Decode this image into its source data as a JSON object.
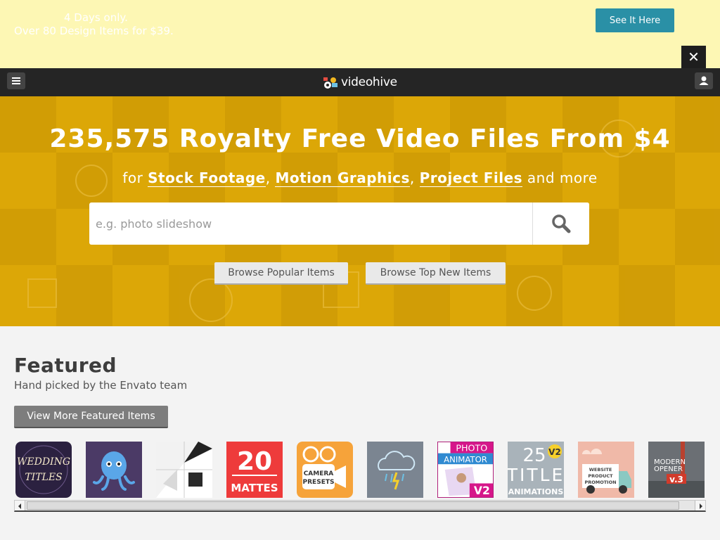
{
  "promo": {
    "line1": "4 Days only.",
    "line2": "Over 80 Design Items for $39.",
    "cta_label": "See It Here",
    "close_glyph": "✕"
  },
  "topbar": {
    "menu_icon": "hamburger-icon",
    "logo_text": "videohive",
    "user_icon": "user-icon"
  },
  "hero": {
    "title": "235,575 Royalty Free Video Files From $4",
    "sub_prefix": "for",
    "categories": [
      "Stock Footage",
      "Motion Graphics",
      "Project Files"
    ],
    "sub_suffix": "and more",
    "search_placeholder": "e.g. photo slideshow",
    "search_icon": "search-icon",
    "browse_popular": "Browse Popular Items",
    "browse_new": "Browse Top New Items"
  },
  "featured": {
    "title": "Featured",
    "subtitle": "Hand picked by the Envato team",
    "more_label": "View More Featured Items",
    "items": [
      {
        "name": "Wedding Titles",
        "lines": [
          "WEDDING",
          "TITLES"
        ],
        "bg": "#2b2140"
      },
      {
        "name": "Octopus Character",
        "lines": [],
        "bg": "#4b3a66"
      },
      {
        "name": "Cubes",
        "lines": [],
        "bg": "#eeeeee"
      },
      {
        "name": "20 Mattes",
        "lines": [
          "20",
          "MATTES"
        ],
        "bg": "#ee3b3b"
      },
      {
        "name": "Camera Presets",
        "lines": [
          "CAMERA",
          "PRESETS"
        ],
        "bg": "#f6a33a"
      },
      {
        "name": "Weather Icons",
        "lines": [],
        "bg": "#7b8591"
      },
      {
        "name": "Photo Animator V2",
        "lines": [
          "PHOTO",
          "ANIMATOR",
          "V2"
        ],
        "bg": "#ffffff"
      },
      {
        "name": "25 Title Animations V2",
        "lines": [
          "25",
          "TITLE",
          "ANIMATIONS",
          "V2"
        ],
        "bg": "#a9b3ba"
      },
      {
        "name": "Website Product Promotion",
        "lines": [
          "WEBSITE",
          "PRODUCT",
          "PROMOTION"
        ],
        "bg": "#f0b9a8"
      },
      {
        "name": "Modern Opener v.3",
        "lines": [
          "MODERN",
          "OPENER",
          "v.3"
        ],
        "bg": "#6b6f74"
      }
    ]
  },
  "colors": {
    "promo_bg": "#fdf7b4",
    "cta": "#2a90a6",
    "topbar": "#252525",
    "hero": "#dba606",
    "page_bg": "#f3f3f3"
  }
}
